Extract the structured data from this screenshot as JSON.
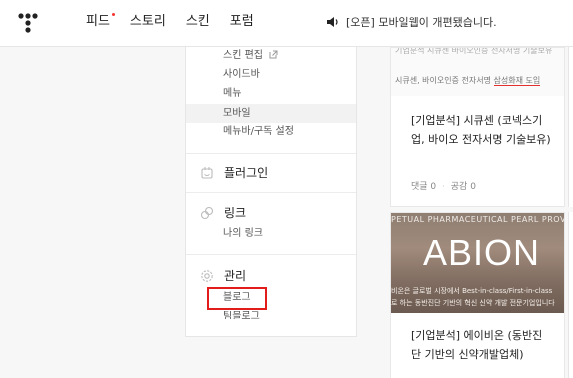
{
  "nav": {
    "items": [
      {
        "label": "피드",
        "has_dot": true
      },
      {
        "label": "스토리",
        "has_dot": false
      },
      {
        "label": "스킨",
        "has_dot": false
      },
      {
        "label": "포럼",
        "has_dot": false
      }
    ],
    "notice": "[오픈] 모바일웹이 개편됐습니다.",
    "notice_icon": "speaker-icon",
    "logo_icon": "tistory-logo-icon",
    "dot_color": "#f53535"
  },
  "menu": {
    "skin_items": [
      "스킨 편집",
      "사이드바",
      "메뉴",
      "모바일",
      "메뉴바/구독 설정"
    ],
    "active_item": "모바일",
    "plugin_label": "플러그인",
    "link_label": "링크",
    "link_items": [
      "나의 링크"
    ],
    "manage_label": "관리",
    "manage_items": [
      "블로그",
      "팀블로그"
    ],
    "highlight_color": "#e21b1b"
  },
  "cards": [
    {
      "thumb_top": "기업분석 시큐센 바이오인증 전자서명 기술보유",
      "thumb_line_pre": "시큐센, 바이오인증 전자서명 ",
      "thumb_line_em": "삼성화재 도입",
      "title": "[기업분석] 시큐센 (코넥스기업, 바이오 전자서명 기술보유)",
      "comments": "댓글 0",
      "likes": "공감 0"
    },
    {
      "img_top": "PETUAL PHARMACEUTICAL PEARL PROV",
      "img_logo": "ABION",
      "img_sub1": "비온은 글로벌 시장에서 Best-in-class/First-in-class",
      "img_sub2": "로 하는 동반진단 기반의 혁신 신약 개발 전문기업입니다",
      "title": "[기업분석] 에이비온 (동반진단 기반의 신약개발업체)"
    }
  ]
}
